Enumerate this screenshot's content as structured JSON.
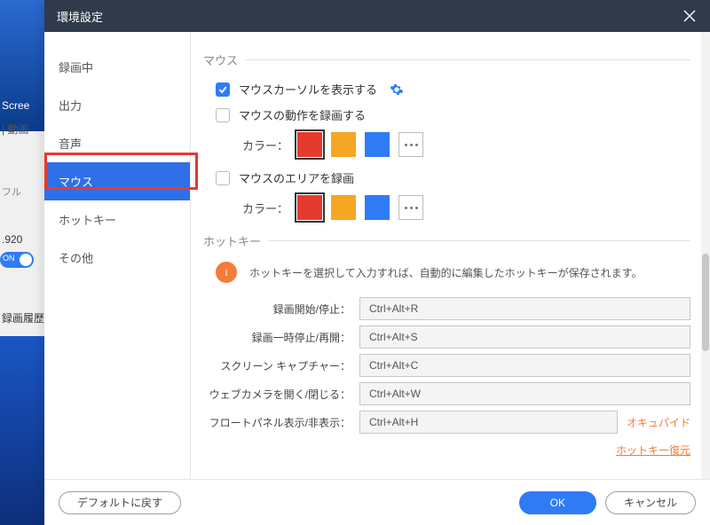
{
  "bg": {
    "screen": "Scree",
    "video": "| 動画",
    "full": "フル",
    "res": ".920",
    "on": "ON",
    "history": "録画履歴"
  },
  "dialog": {
    "title": "環境設定"
  },
  "sidebar": {
    "items": [
      {
        "label": "録画中"
      },
      {
        "label": "出力"
      },
      {
        "label": "音声"
      },
      {
        "label": "マウス"
      },
      {
        "label": "ホットキー"
      },
      {
        "label": "その他"
      }
    ]
  },
  "mouse": {
    "section": "マウス",
    "showCursor": "マウスカーソルを表示する",
    "recordActions": "マウスの動作を録画する",
    "colorLabel1": "カラー：",
    "recordArea": "マウスのエリアを録画",
    "colorLabel2": "カラー：",
    "colors": {
      "red": "#e53a2e",
      "orange": "#f5a623",
      "blue": "#2f7bf5"
    }
  },
  "hotkey": {
    "section": "ホットキー",
    "info": "ホットキーを選択して入力すれば、自動的に編集したホットキーが保存されます。",
    "rows": [
      {
        "label": "録画開始/停止：",
        "value": "Ctrl+Alt+R"
      },
      {
        "label": "録画一時停止/再開：",
        "value": "Ctrl+Alt+S"
      },
      {
        "label": "スクリーン キャプチャー：",
        "value": "Ctrl+Alt+C"
      },
      {
        "label": "ウェブカメラを開く/閉じる：",
        "value": "Ctrl+Alt+W"
      },
      {
        "label": "フロートパネル表示/非表示：",
        "value": "Ctrl+Alt+H"
      }
    ],
    "occupied": "オキュパイド",
    "restore": "ホットキー復元"
  },
  "footer": {
    "defaults": "デフォルトに戻す",
    "ok": "OK",
    "cancel": "キャンセル"
  }
}
